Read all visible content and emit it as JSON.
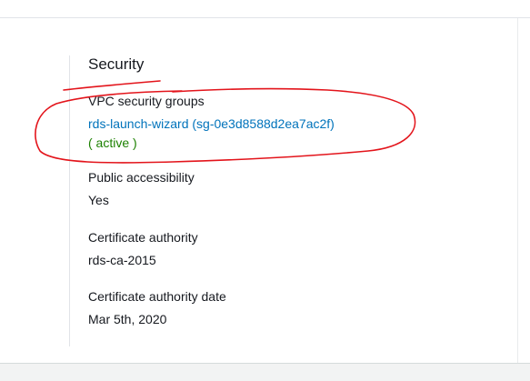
{
  "security": {
    "title": "Security",
    "vpc_security_groups": {
      "label": "VPC security groups",
      "group_link": "rds-launch-wizard (sg-0e3d8588d2ea7ac2f)",
      "status": "( active )"
    },
    "public_accessibility": {
      "label": "Public accessibility",
      "value": "Yes"
    },
    "certificate_authority": {
      "label": "Certificate authority",
      "value": "rds-ca-2015"
    },
    "certificate_authority_date": {
      "label": "Certificate authority date",
      "value": "Mar 5th, 2020"
    }
  },
  "colors": {
    "link": "#0073bb",
    "status_active": "#1d8102",
    "annotation": "#e3141b"
  }
}
